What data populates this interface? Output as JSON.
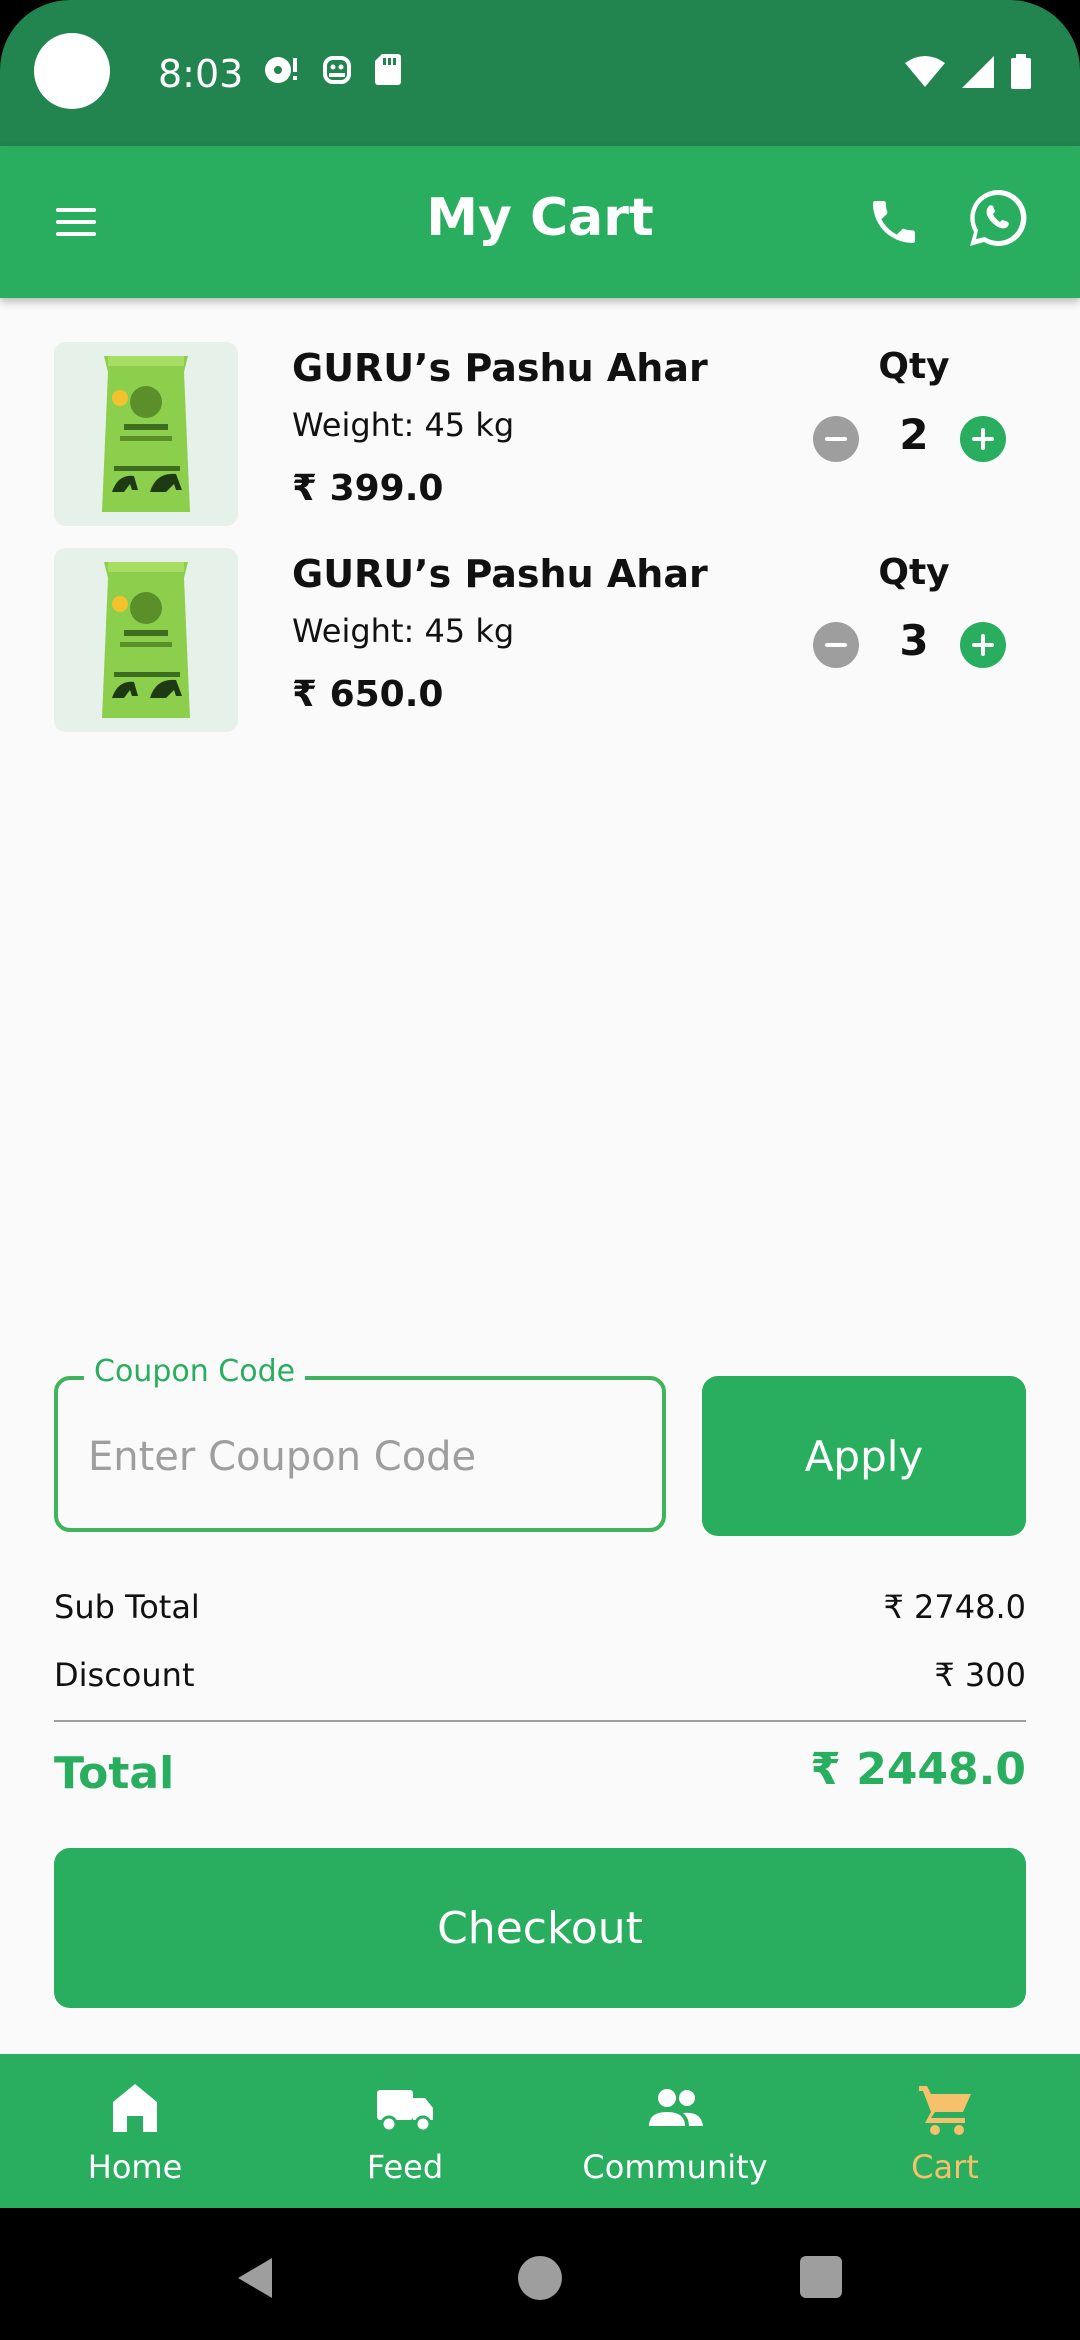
{
  "status_bar": {
    "time": "8:03",
    "left_icons": [
      "notification-icon",
      "android-icon",
      "sd-card-icon"
    ],
    "right_icons": [
      "wifi-icon",
      "signal-icon",
      "battery-icon"
    ]
  },
  "appbar": {
    "title": "My Cart",
    "icons": [
      "menu-icon",
      "phone-icon",
      "whatsapp-icon"
    ]
  },
  "cart": {
    "qty_label": "Qty",
    "items": [
      {
        "name": "GURU’s Pashu Ahar",
        "weight": "Weight: 45 kg",
        "price": "₹ 399.0",
        "qty": "2"
      },
      {
        "name": "GURU’s Pashu Ahar",
        "weight": "Weight: 45 kg",
        "price": "₹ 650.0",
        "qty": "3"
      }
    ]
  },
  "coupon": {
    "label": "Coupon Code",
    "placeholder": "Enter Coupon Code",
    "value": "",
    "apply_label": "Apply"
  },
  "summary": {
    "subtotal_label": "Sub Total",
    "subtotal_value": "₹ 2748.0",
    "discount_label": "Discount",
    "discount_value": "₹ 300",
    "total_label": "Total",
    "total_value": "₹ 2448.0"
  },
  "checkout_label": "Checkout",
  "bottom_nav": {
    "items": [
      {
        "label": "Home",
        "icon": "home-icon"
      },
      {
        "label": "Feed",
        "icon": "truck-icon"
      },
      {
        "label": "Community",
        "icon": "people-icon"
      },
      {
        "label": "Cart",
        "icon": "cart-icon"
      }
    ],
    "active": "Cart"
  },
  "colors": {
    "status_bar": "#22844f",
    "primary": "#29ae5f",
    "active_nav": "#f5c16c",
    "background": "#fafafa"
  }
}
